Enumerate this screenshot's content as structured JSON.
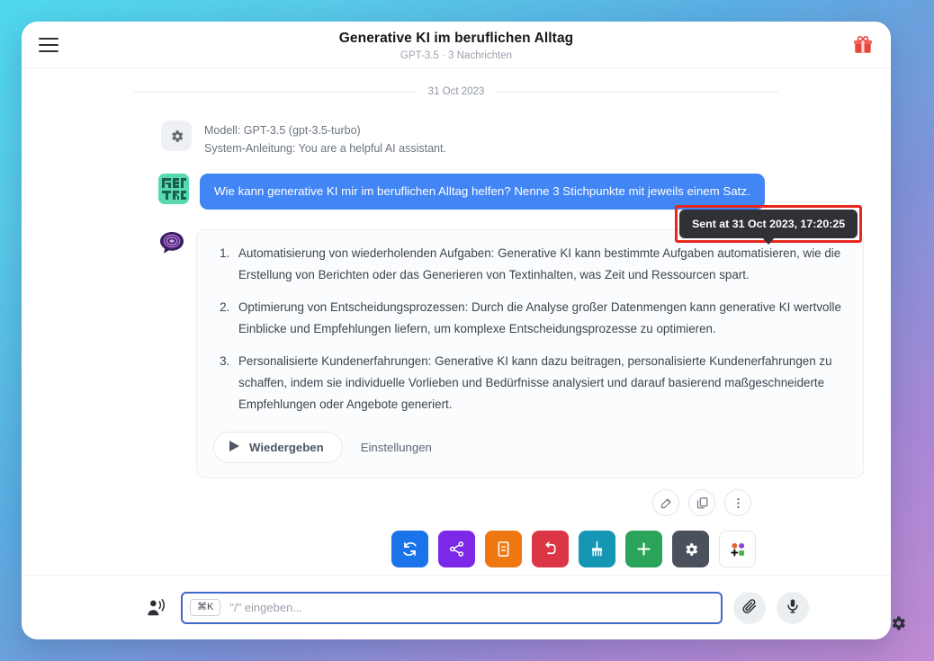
{
  "header": {
    "title": "Generative KI im beruflichen Alltag",
    "subtitle": "GPT-3.5 · 3 Nachrichten",
    "menu_icon": "hamburger-icon",
    "gift_icon": "gift-icon"
  },
  "chat": {
    "date_divider": "31 Oct 2023",
    "system": {
      "icon": "gear-icon",
      "model_line": "Modell: GPT-3.5 (gpt-3.5-turbo)",
      "instruction_line": "System-Anleitung: You are a helpful AI assistant."
    },
    "user_message": {
      "text": "Wie kann generative KI mir im beruflichen Alltag helfen? Nenne 3 Stichpunkte mit jeweils einem Satz.",
      "timestamp": "17:20",
      "avatar": "pixel-avatar"
    },
    "assistant_message": {
      "avatar": "speech-bubble-icon",
      "items": [
        "Automatisierung von wiederholenden Aufgaben: Generative KI kann bestimmte Aufgaben automatisieren, wie die Erstellung von Berichten oder das Generieren von Textinhalten, was Zeit und Ressourcen spart.",
        "Optimierung von Entscheidungsprozessen: Durch die Analyse großer Datenmengen kann generative KI wertvolle Einblicke und Empfehlungen liefern, um komplexe Entscheidungsprozesse zu optimieren.",
        "Personalisierte Kundenerfahrungen: Generative KI kann dazu beitragen, personalisierte Kundenerfahrungen zu schaffen, indem sie individuelle Vorlieben und Bedürfnisse analysiert und darauf basierend maßgeschneiderte Empfehlungen oder Angebote generiert."
      ],
      "play_label": "Wiedergeben",
      "settings_label": "Einstellungen"
    },
    "message_actions": [
      {
        "name": "edit-icon",
        "title": "Bearbeiten"
      },
      {
        "name": "copy-icon",
        "title": "Kopieren"
      },
      {
        "name": "more-vertical-icon",
        "title": "Mehr"
      }
    ]
  },
  "toolbar": [
    {
      "name": "refresh-icon",
      "color": "#1a73e8",
      "title": "Neu generieren"
    },
    {
      "name": "share-icon",
      "color": "#7c28e8",
      "title": "Teilen"
    },
    {
      "name": "notes-icon",
      "color": "#ee7711",
      "title": "Notizen"
    },
    {
      "name": "undo-icon",
      "color": "#dc3545",
      "title": "Zurücksetzen"
    },
    {
      "name": "broom-icon",
      "color": "#1596b4",
      "title": "Leeren"
    },
    {
      "name": "plus-icon",
      "color": "#2aa45a",
      "title": "Hinzufügen"
    },
    {
      "name": "gear-icon",
      "color": "#4b515c",
      "title": "Einstellungen"
    },
    {
      "name": "apps-grid-icon",
      "color": "#ffffff",
      "title": "Apps"
    }
  ],
  "composer": {
    "speak_icon": "speaking-person-icon",
    "shortcut_badge": "⌘K",
    "input_value": "",
    "placeholder": "\"/\" eingeben...",
    "attach_icon": "paperclip-icon",
    "mic_icon": "microphone-icon"
  },
  "tooltip": {
    "text": "Sent at 31 Oct 2023, 17:20:25",
    "highlight_color": "#e8271f"
  },
  "floating": {
    "gear_icon": "gear-icon"
  }
}
